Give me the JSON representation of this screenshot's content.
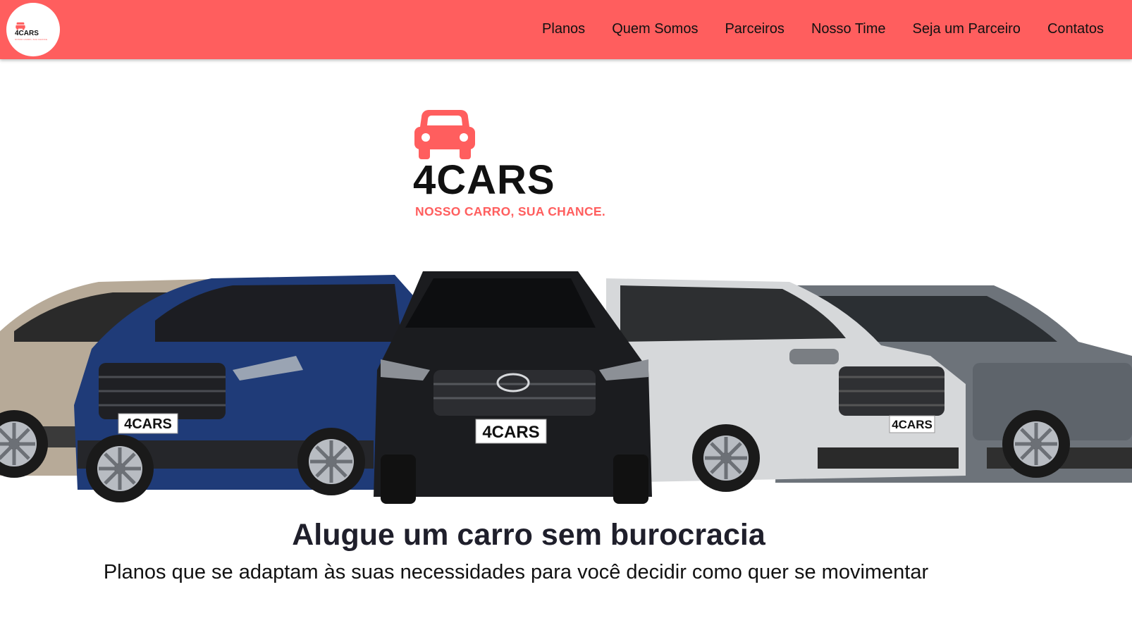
{
  "header": {
    "logo": {
      "name": "4CARS",
      "tagline": "NOSSO CARRO, SUA CHANCE."
    },
    "nav": [
      "Planos",
      "Quem Somos",
      "Parceiros",
      "Nosso Time",
      "Seja um Parceiro",
      "Contatos"
    ]
  },
  "hero": {
    "brand_name": "4CARS",
    "brand_tagline": "NOSSO CARRO, SUA CHANCE.",
    "plate_text": "4CARS",
    "headline": "Alugue um carro sem burocracia",
    "subheadline": "Planos que se adaptam às suas necessidades para você decidir como quer se movimentar"
  },
  "colors": {
    "accent": "#ff5e5e",
    "text": "#111111"
  },
  "icons": {
    "logo": "car-icon"
  }
}
